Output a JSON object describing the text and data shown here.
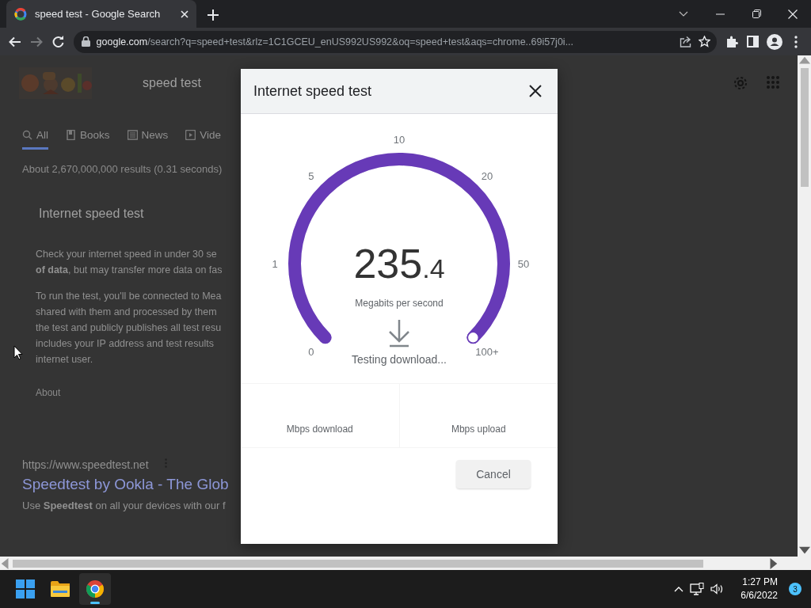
{
  "browser": {
    "tab": {
      "title": "speed test - Google Search",
      "selected": true
    },
    "address_host": "google.com",
    "address_path": "/search?q=speed+test&rlz=1C1GCEU_enUS992US992&oq=speed+test&aqs=chrome..69i57j0i..."
  },
  "page": {
    "query": "speed test",
    "tabs": [
      {
        "label": "All",
        "kind": "search",
        "selected": true
      },
      {
        "label": "Books",
        "kind": "book",
        "selected": false
      },
      {
        "label": "News",
        "kind": "news",
        "selected": false
      },
      {
        "label": "Vide",
        "kind": "video",
        "selected": false
      }
    ],
    "result_stats": "About 2,670,000,000 results (0.31 seconds)",
    "card_title": "Internet speed test",
    "card_lines": [
      "Check your internet speed in under 30 se",
      "**of data**, but may transfer more data on fas"
    ],
    "card_lines_2": [
      "To run the test, you'll be connected to Mea",
      "shared with them and processed by them",
      "the test and publicly publishes all test resu",
      "includes your IP address and test results",
      "internet user."
    ],
    "about": "About",
    "result": {
      "url": "https://www.speedtest.net",
      "title": "Speedtest by Ookla - The Glob",
      "snippet": "Use **Speedtest** on all your devices with our f"
    }
  },
  "dialog": {
    "title": "Internet speed test",
    "gauge": {
      "level": 1,
      "scale": [
        "0",
        "1",
        "5",
        "10",
        "20",
        "50",
        "100+"
      ]
    },
    "reading": "235",
    "reading_decimal": ".4",
    "unit": "Megabits per second",
    "status": "Testing download...",
    "stats": [
      "Mbps download",
      "Mbps upload"
    ],
    "button": "Cancel"
  },
  "taskbar": {
    "apps": [
      {
        "kind": "folder",
        "selected": false
      },
      {
        "kind": "browser",
        "selected": true
      }
    ],
    "time": "1:27 PM",
    "date": "6/6/2022",
    "notifications": "3"
  }
}
